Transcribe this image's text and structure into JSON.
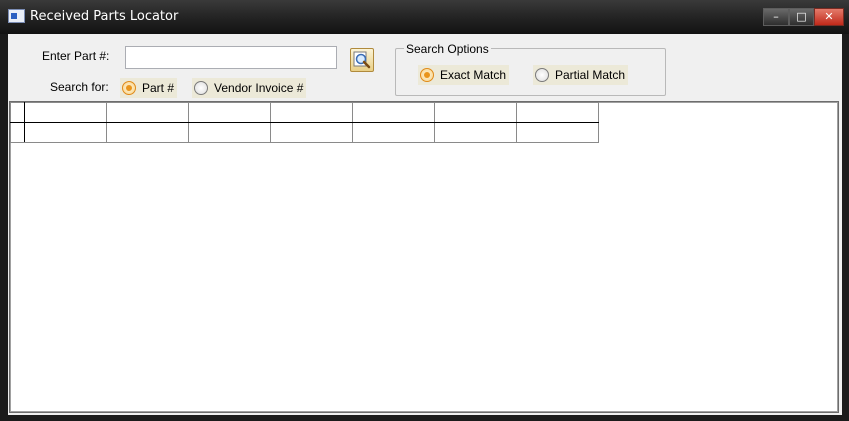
{
  "window": {
    "title": "Received Parts Locator",
    "controls": {
      "minimize": "–",
      "maximize": "□",
      "close": "✕"
    }
  },
  "search": {
    "part_label": "Enter Part #:",
    "part_value": "",
    "search_for_label": "Search for:",
    "search_for_options": [
      {
        "label": "Part #",
        "selected": true
      },
      {
        "label": "Vendor Invoice #",
        "selected": false
      }
    ]
  },
  "search_options": {
    "legend": "Search Options",
    "options": [
      {
        "label": "Exact Match",
        "selected": true
      },
      {
        "label": "Partial Match",
        "selected": false
      }
    ]
  },
  "grid": {
    "columns": 7,
    "rows": 2
  },
  "icons": {
    "app": "app-window-icon",
    "search": "magnifier-icon"
  },
  "colors": {
    "titlebar": "#262626",
    "client_bg": "#f0f0f0",
    "radio_selected": "#e9951c",
    "close_button": "#c0291a"
  }
}
